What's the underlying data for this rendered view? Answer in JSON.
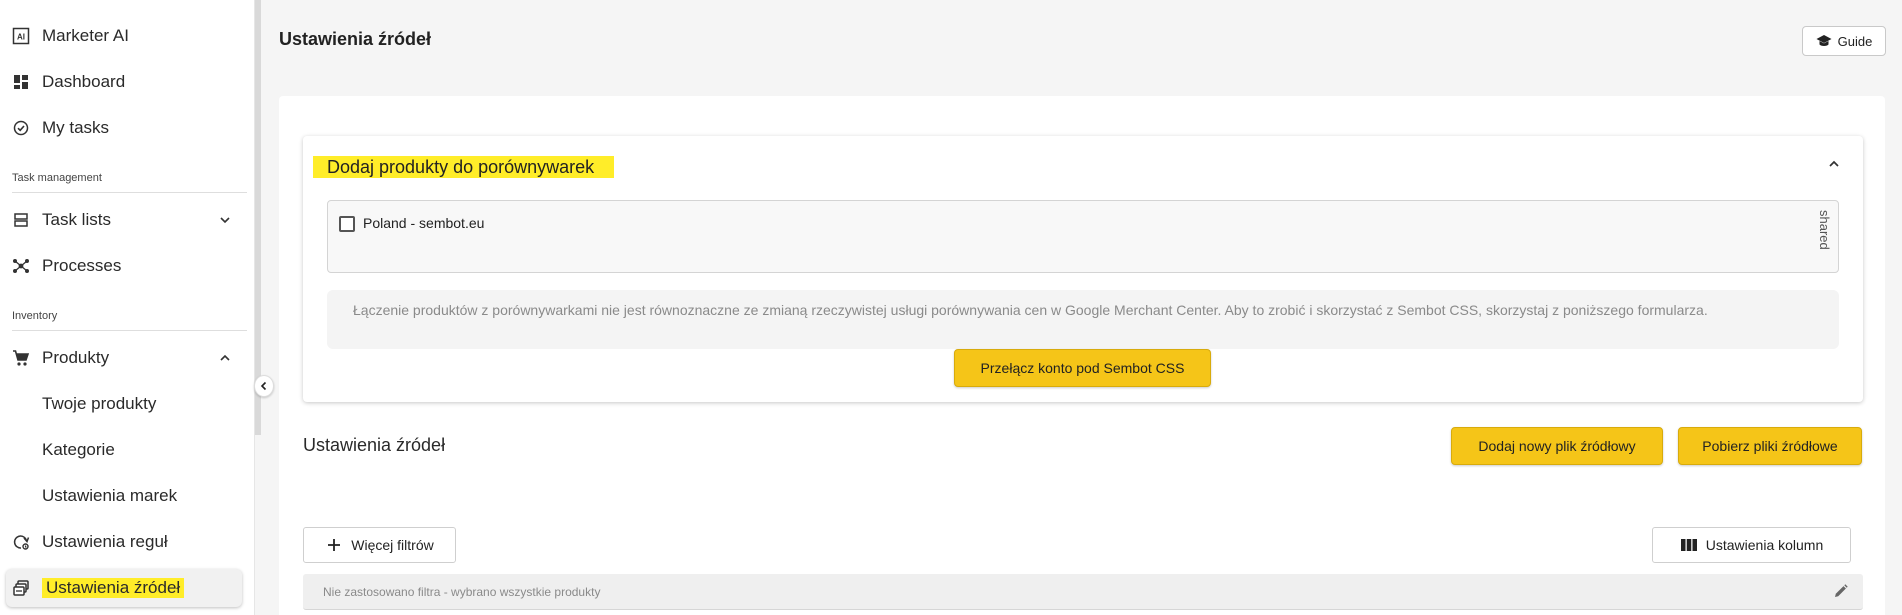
{
  "sidebar": {
    "items": [
      {
        "label": "Marketer AI",
        "icon": "ai-icon"
      },
      {
        "label": "Dashboard",
        "icon": "dashboard-icon"
      },
      {
        "label": "My tasks",
        "icon": "check-circle-icon"
      }
    ],
    "section_task_management": "Task management",
    "task_items": [
      {
        "label": "Task lists",
        "icon": "task-list-icon"
      },
      {
        "label": "Processes",
        "icon": "processes-icon"
      }
    ],
    "section_inventory": "Inventory",
    "inventory_items": [
      {
        "label": "Produkty",
        "icon": "cart-icon"
      },
      {
        "label": "Twoje produkty"
      },
      {
        "label": "Kategorie"
      },
      {
        "label": "Ustawienia marek"
      },
      {
        "label": "Ustawienia reguł",
        "icon": "rules-icon"
      },
      {
        "label": "Ustawienia źródeł",
        "icon": "feeds-icon",
        "active": true
      }
    ]
  },
  "header": {
    "title": "Ustawienia źródeł",
    "guide_label": "Guide"
  },
  "comparators": {
    "title": "Dodaj produkty do porównywarek",
    "shop_label": "Poland - sembot.eu",
    "shared_label": "shared",
    "info_text": "Łączenie produktów z porównywarkami nie jest równoznaczne ze zmianą rzeczywistej usługi porównywania cen w Google Merchant Center. Aby to zrobić i skorzystać z Sembot CSS, skorzystaj z poniższego formularza.",
    "switch_button": "Przełącz konto pod Sembot CSS"
  },
  "feeds": {
    "title": "Ustawienia źródeł",
    "add_button": "Dodaj nowy plik źródłowy",
    "download_button": "Pobierz pliki źródłowe",
    "filters_button": "Więcej filtrów",
    "columns_button": "Ustawienia kolumn",
    "filter_status": "Nie zastosowano filtra - wybrano wszystkie produkty"
  },
  "colors": {
    "accent_yellow": "#f5c518",
    "highlight": "#ffed29"
  }
}
